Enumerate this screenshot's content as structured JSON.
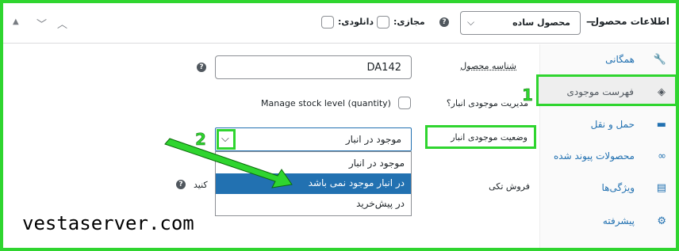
{
  "header": {
    "title": "اطلاعات محصول",
    "dash": "—",
    "product_type": "محصول ساده",
    "virtual_label": "مجازی:",
    "download_label": "دانلودی:",
    "help": "?"
  },
  "sidebar": {
    "items": [
      {
        "label": "همگانی",
        "icon": "wrench-icon",
        "glyph": "🔧"
      },
      {
        "label": "فهرست موجودی",
        "icon": "tag-icon",
        "glyph": "◈"
      },
      {
        "label": "حمل و نقل",
        "icon": "truck-icon",
        "glyph": "▬"
      },
      {
        "label": "محصولات پیوند شده",
        "icon": "link-icon",
        "glyph": "∞"
      },
      {
        "label": "ویژگی‌ها",
        "icon": "list-icon",
        "glyph": "▤"
      },
      {
        "label": "پیشرفته",
        "icon": "gear-icon",
        "glyph": "⚙"
      }
    ]
  },
  "form": {
    "sku_label": "شناسه محصول",
    "sku_value": "DA142",
    "manage_label": "مدیریت موجودی انبار؟",
    "manage_text": "Manage stock level (quantity)",
    "stock_status_label": "وضعیت موجودی انبار",
    "stock_status_value": "موجود در انبار",
    "sold_individually_label": "فروش تکی",
    "sold_individually_partial": "کنید",
    "options": [
      "موجود در انبار",
      "در انبار موجود نمی باشد",
      "در پیش‌خرید"
    ]
  },
  "annotations": {
    "marker_1": "1",
    "marker_2": "2",
    "highlight_color": "#2fd52f"
  },
  "watermark": "vestaserver.com"
}
